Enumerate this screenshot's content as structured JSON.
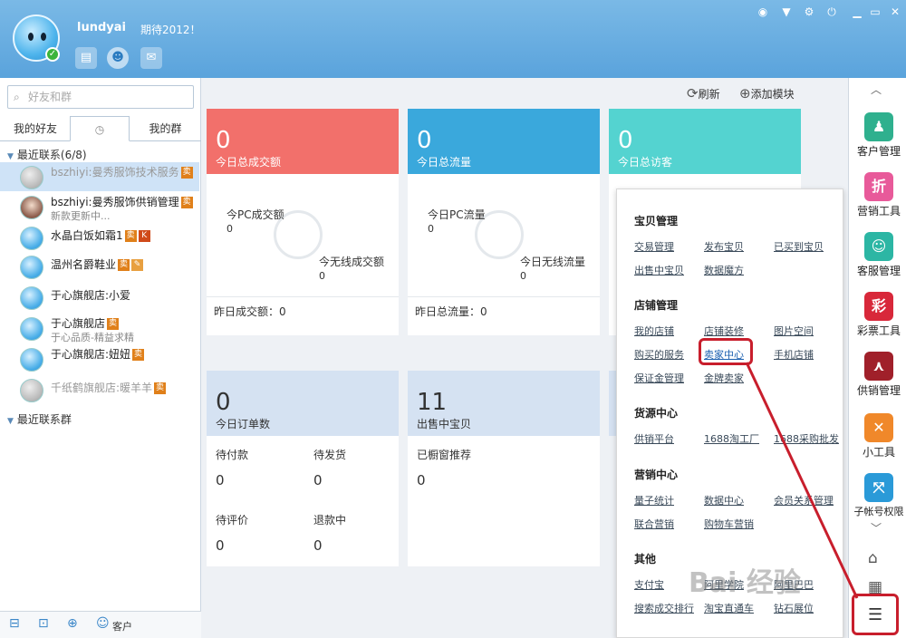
{
  "user": {
    "name": "lundyai",
    "signature": "期待2012！"
  },
  "search": {
    "placeholder": "好友和群"
  },
  "tabs": [
    "我的好友",
    "",
    "我的群"
  ],
  "groups": [
    {
      "label": "最近联系(6/8)"
    },
    {
      "label": "最近联系群"
    }
  ],
  "contacts": [
    {
      "name": "bszhiyi:曼秀服饰技术服务",
      "sub": ""
    },
    {
      "name": "bszhiyi:曼秀服饰供销管理",
      "sub": "新款更新中..."
    },
    {
      "name": "水晶白饭如霜1",
      "sub": ""
    },
    {
      "name": "温州名爵鞋业",
      "sub": ""
    },
    {
      "name": "于心旗舰店:小爱",
      "sub": ""
    },
    {
      "name": "于心旗舰店",
      "sub": "于心品质-精益求精"
    },
    {
      "name": "于心旗舰店:妞妞",
      "sub": ""
    },
    {
      "name": "千纸鹤旗舰店:暖羊羊",
      "sub": ""
    }
  ],
  "footer": {
    "customer_label": "客户"
  },
  "main": {
    "refresh_label": "刷新",
    "add_module_label": "添加模块",
    "cards": [
      {
        "value": "0",
        "label": "今日总成交额",
        "color": "#f2706b",
        "left_label": "今PC成交额",
        "left_value": "0",
        "right_label": "今无线成交额",
        "right_value": "0",
        "footer": "昨日成交额：0"
      },
      {
        "value": "0",
        "label": "今日总流量",
        "color": "#3aa8dc",
        "left_label": "今日PC流量",
        "left_value": "0",
        "right_label": "今日无线流量",
        "right_value": "0",
        "footer": "昨日总流量：0"
      },
      {
        "value": "0",
        "label": "今日总访客",
        "color": "#54d3d0"
      }
    ],
    "order_card": {
      "value": "0",
      "label": "今日订单数",
      "items": [
        {
          "label": "待付款",
          "value": "0"
        },
        {
          "label": "待发货",
          "value": "0"
        },
        {
          "label": "待评价",
          "value": "0"
        },
        {
          "label": "退款中",
          "value": "0"
        }
      ]
    },
    "goods_card": {
      "value": "11",
      "label": "出售中宝贝",
      "item_label": "已橱窗推荐",
      "item_value": "0"
    }
  },
  "tools": [
    {
      "label": "客户管理",
      "color": "#2fb08e",
      "glyph": "♟"
    },
    {
      "label": "营销工具",
      "color": "#e85a9a",
      "glyph": "折"
    },
    {
      "label": "客服管理",
      "color": "#2cb6a4",
      "glyph": "☺"
    },
    {
      "label": "彩票工具",
      "color": "#d8283a",
      "glyph": "彩"
    },
    {
      "label": "供销管理",
      "color": "#a0202a",
      "glyph": "⋏"
    },
    {
      "label": "小工具",
      "color": "#f0882a",
      "glyph": "✕"
    },
    {
      "label": "子帐号权限",
      "color": "#2a9ad8",
      "glyph": "⤧"
    }
  ],
  "popup": {
    "sections": [
      {
        "title": "宝贝管理",
        "links": [
          "交易管理",
          "发布宝贝",
          "已买到宝贝",
          "出售中宝贝",
          "数据魔方"
        ]
      },
      {
        "title": "店铺管理",
        "links": [
          "我的店铺",
          "店铺装修",
          "图片空间",
          "购买的服务",
          "卖家中心",
          "手机店铺",
          "保证金管理",
          "金牌卖家"
        ]
      },
      {
        "title": "货源中心",
        "links": [
          "供销平台",
          "1688淘工厂",
          "1688采购批发"
        ]
      },
      {
        "title": "营销中心",
        "links": [
          "量子统计",
          "数据中心",
          "会员关系管理",
          "联合营销",
          "购物车营销"
        ]
      },
      {
        "title": "其他",
        "links": [
          "支付宝",
          "阿里学院",
          "阿里巴巴",
          "搜索成交排行",
          "淘宝直通车",
          "钻石展位"
        ]
      }
    ]
  },
  "watermark": "Bai 经验"
}
